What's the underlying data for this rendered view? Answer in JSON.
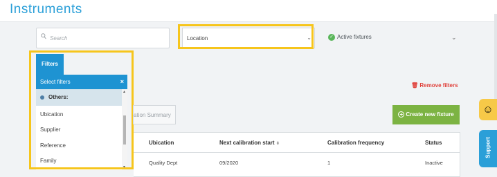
{
  "header": {
    "title": "Instruments"
  },
  "search": {
    "placeholder": "Search"
  },
  "location_select": {
    "value": "Location"
  },
  "active_fixtures": {
    "label": "Active fixtures"
  },
  "filters": {
    "tab_label": "Filters",
    "select_label": "Select filters",
    "group_label": "Others:",
    "items": [
      "Ubication",
      "Supplier",
      "Reference",
      "Family"
    ]
  },
  "remove_filters": "Remove filters",
  "summary_button": "ation Summary",
  "create_button": "Create new fixture",
  "table": {
    "columns": [
      "Ubication",
      "Next calibration start",
      "Calibration frequency",
      "Status"
    ],
    "rows": [
      {
        "ubication": "Quality Dept",
        "next_calibration_start": "09/2020",
        "calibration_frequency": "1",
        "status": "Inactive"
      }
    ]
  },
  "side": {
    "support_label": "Support"
  },
  "colors": {
    "accent": "#1e93d2",
    "highlight": "#f6c51c",
    "create": "#7cb342",
    "remove": "#e0403a"
  }
}
